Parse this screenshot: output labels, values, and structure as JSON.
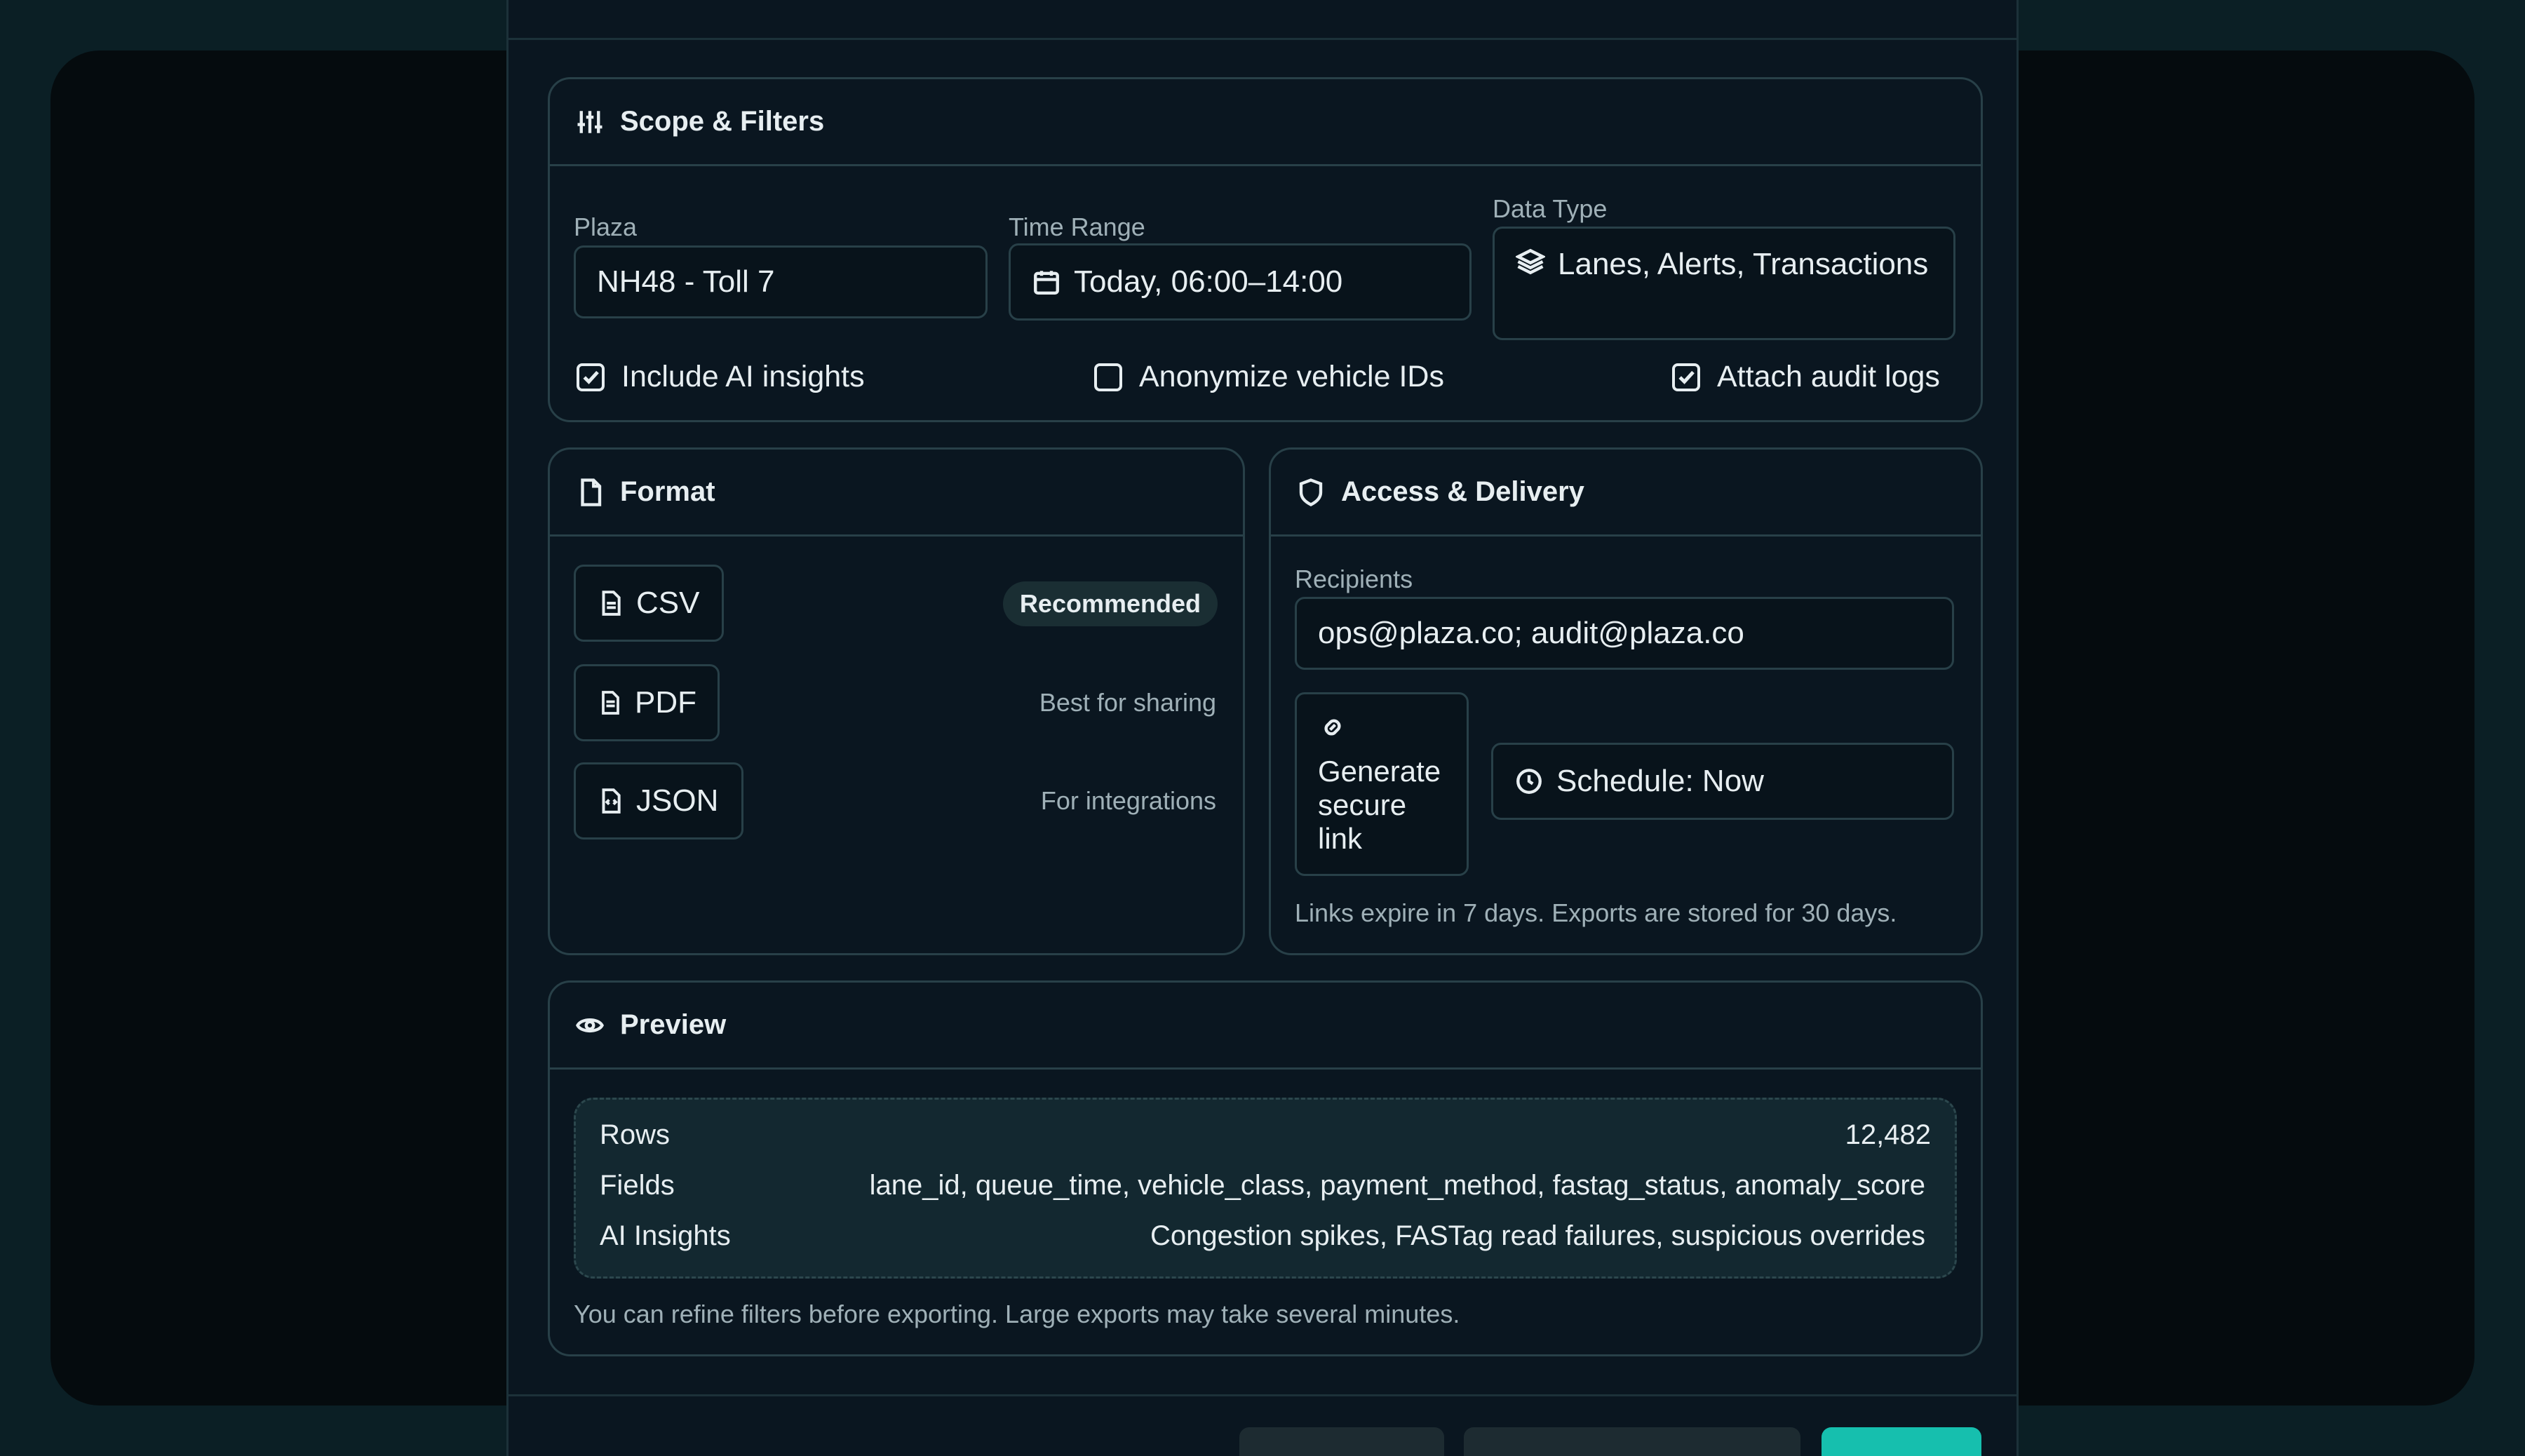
{
  "scope": {
    "title": "Scope & Filters",
    "plaza_label": "Plaza",
    "plaza_value": "NH48 - Toll 7",
    "time_label": "Time Range",
    "time_value": "Today, 06:00–14:00",
    "type_label": "Data Type",
    "type_value": "Lanes, Alerts, Transactions",
    "options": [
      {
        "label": "Include AI insights",
        "checked": true
      },
      {
        "label": "Anonymize vehicle IDs",
        "checked": false
      },
      {
        "label": "Attach audit logs",
        "checked": true
      }
    ]
  },
  "format": {
    "title": "Format",
    "items": [
      {
        "label": "CSV",
        "note": "Recommended"
      },
      {
        "label": "PDF",
        "note": "Best for sharing"
      },
      {
        "label": "JSON",
        "note": "For integrations"
      }
    ]
  },
  "access": {
    "title": "Access & Delivery",
    "recipients_label": "Recipients",
    "recipients_value": "ops@plaza.co; audit@plaza.co",
    "link_button": "Generate secure link",
    "schedule": "Schedule: Now",
    "note": "Links expire in 7 days. Exports are stored for 30 days."
  },
  "preview": {
    "title": "Preview",
    "rows_label": "Rows",
    "rows_value": "12,482",
    "fields_label": "Fields",
    "fields_value": "lane_id, queue_time, vehicle_class, payment_method, fastag_status, anomaly_score",
    "ai_label": "AI Insights",
    "ai_value": "Congestion spikes, FASTag read failures, suspicious overrides",
    "note": "You can refine filters before exporting. Large exports may take several minutes."
  },
  "colors": {
    "accent": "#16bfae",
    "background": "#0b1f25",
    "modal": "#0a1620"
  }
}
